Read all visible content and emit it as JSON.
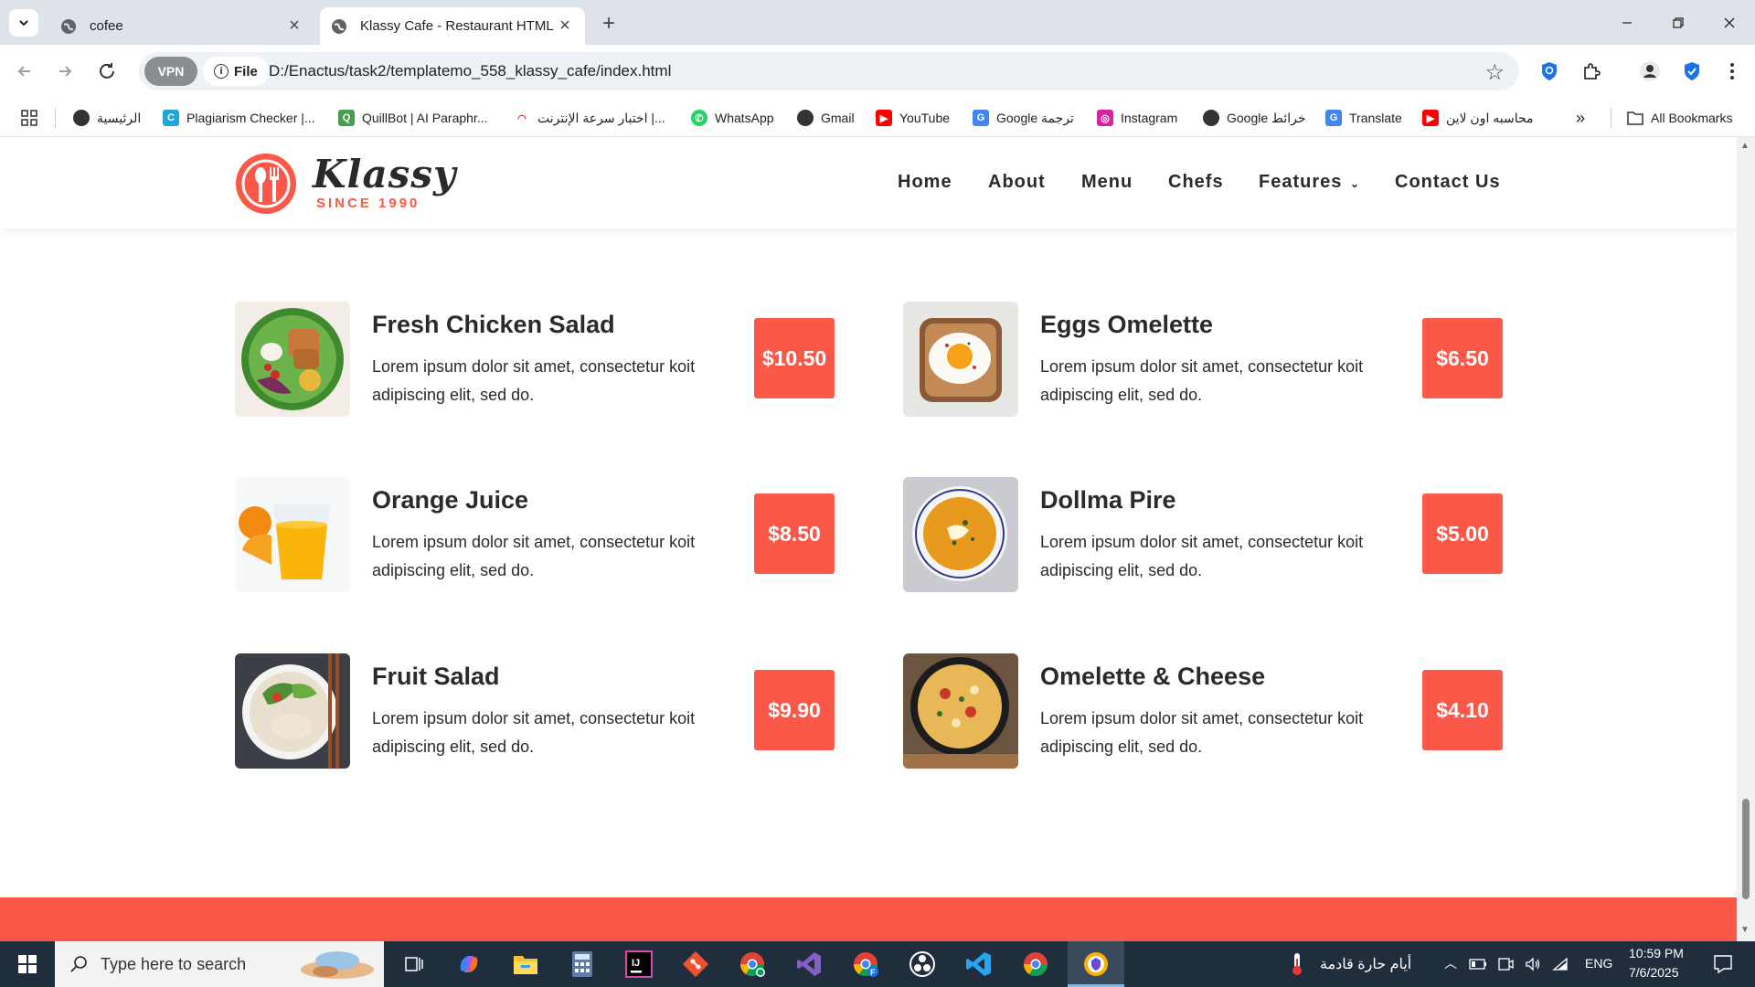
{
  "browser": {
    "tabs": [
      {
        "title": "cofee",
        "active": false
      },
      {
        "title": "Klassy Cafe - Restaurant HTML T",
        "active": true
      }
    ],
    "url_scheme_label": "File",
    "vpn_label": "VPN",
    "url": "D:/Enactus/task2/templatemo_558_klassy_cafe/index.html",
    "bookmarks": [
      {
        "label": "الرئيسية",
        "icon": "globe-icon"
      },
      {
        "label": "Plagiarism Checker |...",
        "icon": "plagiarism-icon"
      },
      {
        "label": "QuillBot | AI Paraphr...",
        "icon": "quillbot-icon"
      },
      {
        "label": "اختبار سرعة الإنترنت |...",
        "icon": "speedtest-icon"
      },
      {
        "label": "WhatsApp",
        "icon": "whatsapp-icon"
      },
      {
        "label": "Gmail",
        "icon": "globe-icon"
      },
      {
        "label": "YouTube",
        "icon": "youtube-icon"
      },
      {
        "label": "Google ترجمة",
        "icon": "translate-icon"
      },
      {
        "label": "Instagram",
        "icon": "instagram-icon"
      },
      {
        "label": "Google خرائط",
        "icon": "globe-icon"
      },
      {
        "label": "Translate",
        "icon": "translate-icon"
      },
      {
        "label": "محاسبه اون لاين",
        "icon": "youtube-icon"
      }
    ],
    "all_bookmarks_label": "All Bookmarks"
  },
  "site": {
    "logo_name": "Klassy",
    "logo_since": "SINCE 1990",
    "nav": [
      "Home",
      "About",
      "Menu",
      "Chefs",
      "Features",
      "Contact Us"
    ],
    "accent_color": "#fb5849",
    "menu_items": [
      {
        "name": "Fresh Chicken Salad",
        "desc": "Lorem ipsum dolor sit amet, consectetur koit adipiscing elit, sed do.",
        "price": "$10.50",
        "image": "salad-bowl"
      },
      {
        "name": "Eggs Omelette",
        "desc": "Lorem ipsum dolor sit amet, consectetur koit adipiscing elit, sed do.",
        "price": "$6.50",
        "image": "egg-toast"
      },
      {
        "name": "Orange Juice",
        "desc": "Lorem ipsum dolor sit amet, consectetur koit adipiscing elit, sed do.",
        "price": "$8.50",
        "image": "orange-juice"
      },
      {
        "name": "Dollma Pire",
        "desc": "Lorem ipsum dolor sit amet, consectetur koit adipiscing elit, sed do.",
        "price": "$5.00",
        "image": "soup-bowl"
      },
      {
        "name": "Fruit Salad",
        "desc": "Lorem ipsum dolor sit amet, consectetur koit adipiscing elit, sed do.",
        "price": "$9.90",
        "image": "noodle-bowl"
      },
      {
        "name": "Omelette & Cheese",
        "desc": "Lorem ipsum dolor sit amet, consectetur koit adipiscing elit, sed do.",
        "price": "$4.10",
        "image": "skillet-omelette"
      }
    ]
  },
  "taskbar": {
    "search_placeholder": "Type here to search",
    "weather_text": "أيام حارة قادمة",
    "language": "ENG",
    "time": "10:59 PM",
    "date": "7/6/2025"
  }
}
